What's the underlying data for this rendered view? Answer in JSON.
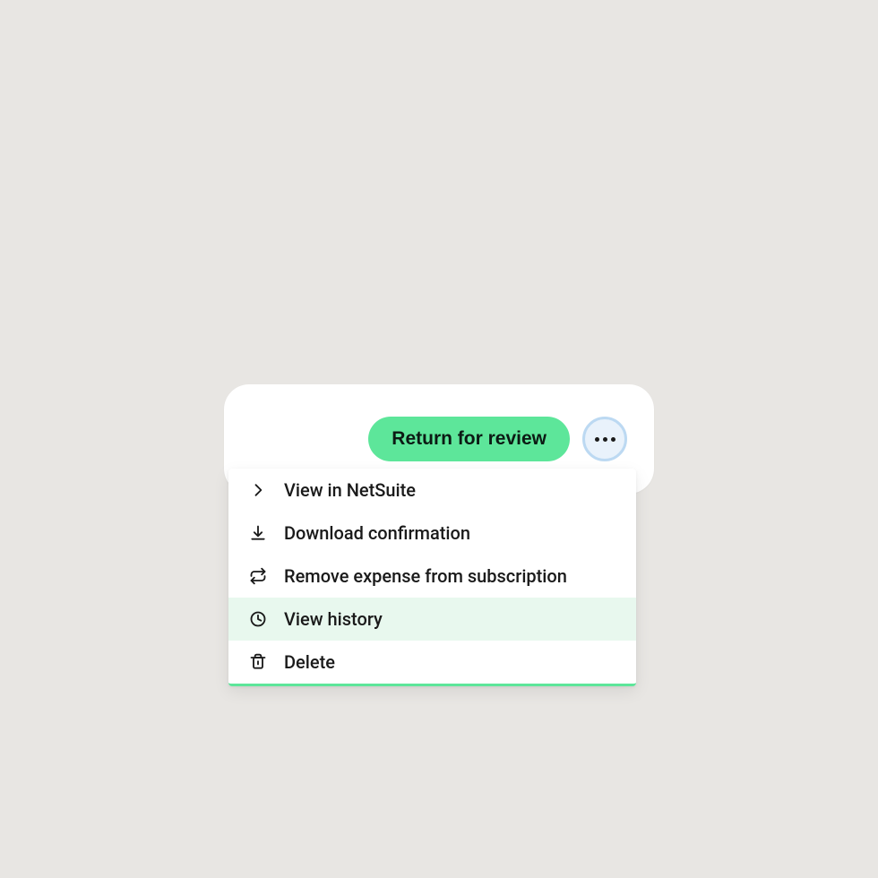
{
  "toolbar": {
    "return_label": "Return for review"
  },
  "menu": {
    "items": [
      {
        "label": "View in NetSuite",
        "icon": "chevron-right-icon",
        "highlighted": false
      },
      {
        "label": "Download confirmation",
        "icon": "download-icon",
        "highlighted": false
      },
      {
        "label": "Remove expense from subscription",
        "icon": "refresh-icon",
        "highlighted": false
      },
      {
        "label": "View history",
        "icon": "clock-icon",
        "highlighted": true
      },
      {
        "label": "Delete",
        "icon": "trash-icon",
        "highlighted": false
      }
    ]
  }
}
